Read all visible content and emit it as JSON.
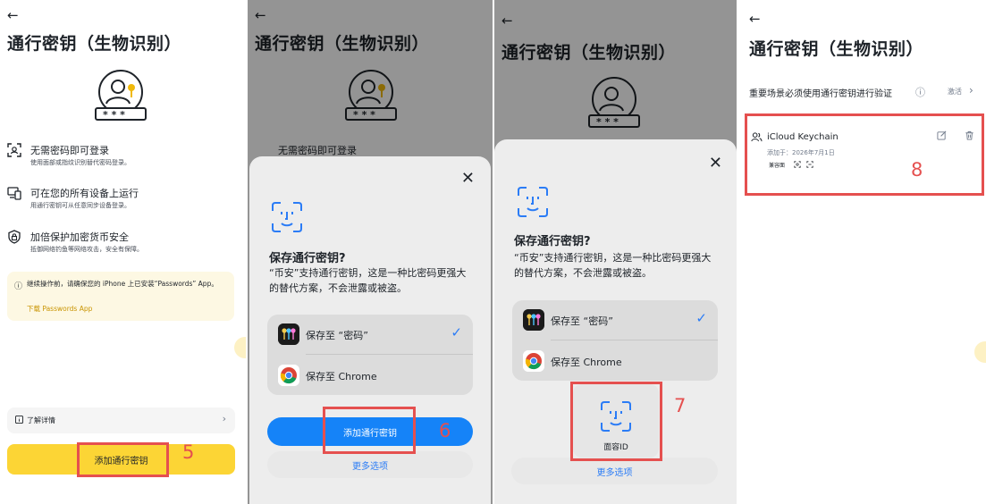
{
  "panel1": {
    "back": "←",
    "title": "通行密钥（生物识别）",
    "features": [
      {
        "icon": "face-scan-icon",
        "title": "无需密码即可登录",
        "desc": "使用面部或指纹识别替代密码登录。"
      },
      {
        "icon": "devices-icon",
        "title": "可在您的所有设备上运行",
        "desc": "用通行密钥可从任意同步设备登录。"
      },
      {
        "icon": "lock-shield-icon",
        "title": "加倍保护加密货币安全",
        "desc": "抵御网络钓鱼等网络攻击，安全有保障。"
      }
    ],
    "note": {
      "icon": "ⓘ",
      "text": "继续操作前，请确保您的 iPhone 上已安装“Passwords” App。",
      "link": "下载 Passwords App"
    },
    "learn_more": "了解详情",
    "learn_chevron": "›",
    "primary_button": "添加通行密钥",
    "step": "5"
  },
  "panel2": {
    "back": "←",
    "title": "通行密钥（生物识别）",
    "sheet_close": "✕",
    "sheet_title": "保存通行密钥?",
    "sheet_desc": "“币安”支持通行密钥，这是一种比密码更强大的替代方案，不会泄露或被盗。",
    "options": [
      {
        "label": "保存至 “密码”",
        "checked": true,
        "icon": "passwords-app-icon"
      },
      {
        "label": "保存至 Chrome",
        "checked": false,
        "icon": "chrome-icon"
      }
    ],
    "check_glyph": "✓",
    "primary_button": "添加通行密钥",
    "secondary_button": "更多选项",
    "step": "6"
  },
  "panel3": {
    "back": "←",
    "title": "通行密钥（生物识别）",
    "sheet_close": "✕",
    "sheet_title": "保存通行密钥?",
    "sheet_desc": "“币安”支持通行密钥，这是一种比密码更强大的替代方案，不会泄露或被盗。",
    "options": [
      {
        "label": "保存至 “密码”",
        "checked": true,
        "icon": "passwords-app-icon"
      },
      {
        "label": "保存至 Chrome",
        "checked": false,
        "icon": "chrome-icon"
      }
    ],
    "check_glyph": "✓",
    "faceid_label": "面容ID",
    "secondary_button": "更多选项",
    "step": "7"
  },
  "panel4": {
    "back": "←",
    "title": "通行密钥（生物识别）",
    "setting_label": "重要场景必须使用通行密钥进行验证",
    "setting_info": "ⓘ",
    "setting_value": "激活",
    "setting_chevron": "›",
    "keychain_name": "iCloud Keychain",
    "keychain_added": "添加于：2026年7月1日",
    "keychain_devices": "兼容面",
    "step": "8"
  },
  "colors": {
    "brand_yellow": "#fcd535",
    "highlight_red": "#e5504f",
    "ios_blue": "#1583f8"
  }
}
